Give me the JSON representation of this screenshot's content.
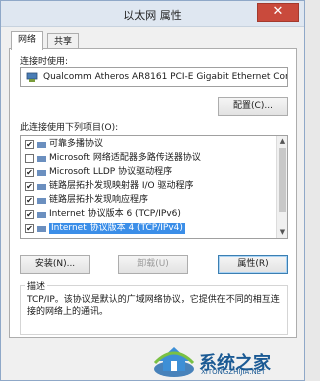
{
  "window": {
    "title": "以太网 属性",
    "close_glyph": "✕"
  },
  "tabs": [
    {
      "label": "网络"
    },
    {
      "label": "共享"
    }
  ],
  "connect_using": {
    "label": "连接时使用:",
    "device": "Qualcomm Atheros AR8161 PCI-E Gigabit Ethernet Cor",
    "configure_button": "配置(C)..."
  },
  "items_section": {
    "label": "此连接使用下列项目(O):",
    "items": [
      {
        "checked": true,
        "text": "可靠多播协议"
      },
      {
        "checked": false,
        "text": "Microsoft 网络适配器多路传送器协议"
      },
      {
        "checked": true,
        "text": "Microsoft LLDP 协议驱动程序"
      },
      {
        "checked": true,
        "text": "链路层拓扑发现映射器 I/O 驱动程序"
      },
      {
        "checked": true,
        "text": "链路层拓扑发现响应程序"
      },
      {
        "checked": true,
        "text": "Internet 协议版本 6 (TCP/IPv6)"
      },
      {
        "checked": true,
        "text": "Internet 协议版本 4 (TCP/IPv4)",
        "selected": true
      }
    ]
  },
  "buttons": {
    "install": "安装(N)...",
    "uninstall": "卸载(U)",
    "properties": "属性(R)"
  },
  "description": {
    "legend": "描述",
    "text": "TCP/IP。该协议是默认的广域网络协议，它提供在不同的相互连接的网络上的通讯。"
  },
  "watermark": {
    "text": "系统之家",
    "url": "XITONGZHIJIA.NET"
  },
  "colors": {
    "selection": "#3b8ee8",
    "close": "#c94a3c",
    "brand": "#1b5a94"
  }
}
